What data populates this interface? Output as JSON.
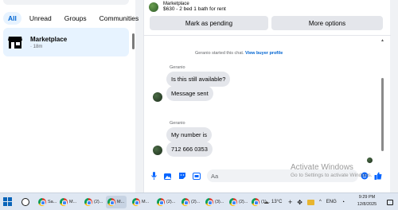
{
  "sidebar": {
    "filters": [
      "All",
      "Unread",
      "Groups",
      "Communities"
    ],
    "conversation": {
      "title": "Marketplace",
      "time": "· 18m"
    }
  },
  "chat": {
    "listing": {
      "title": "Marketplace",
      "subtitle": "$630 - 2 bed 1 bath for rent"
    },
    "buttons": {
      "mark_pending": "Mark as pending",
      "more_options": "More options"
    },
    "system_message": {
      "text": "Geranio started this chat.",
      "link": "View buyer profile"
    },
    "groups": [
      {
        "sender": "Geranio",
        "messages": [
          "Is this still available?",
          "Message sent"
        ]
      },
      {
        "sender": "Geranio",
        "messages": [
          "My number is",
          "712 666 0353"
        ]
      }
    ],
    "composer": {
      "placeholder": "Aa"
    }
  },
  "watermark": {
    "title": "Activate Windows",
    "subtitle": "Go to Settings to activate Windows."
  },
  "taskbar": {
    "apps": [
      {
        "label": "Sa..."
      },
      {
        "label": "M..."
      },
      {
        "label": "(2)..."
      },
      {
        "label": "M..."
      },
      {
        "label": "M..."
      },
      {
        "label": "(2)..."
      },
      {
        "label": "(2)..."
      },
      {
        "label": "(3)..."
      },
      {
        "label": "(2)..."
      },
      {
        "label": "(1)..."
      }
    ],
    "weather": "13°C",
    "language": "ENG",
    "time": "9:29 PM",
    "date": "12/8/2025"
  },
  "colors": {
    "accent": "#0064d1",
    "bubble": "#e4e6eb",
    "selected": "#e7f3ff"
  }
}
